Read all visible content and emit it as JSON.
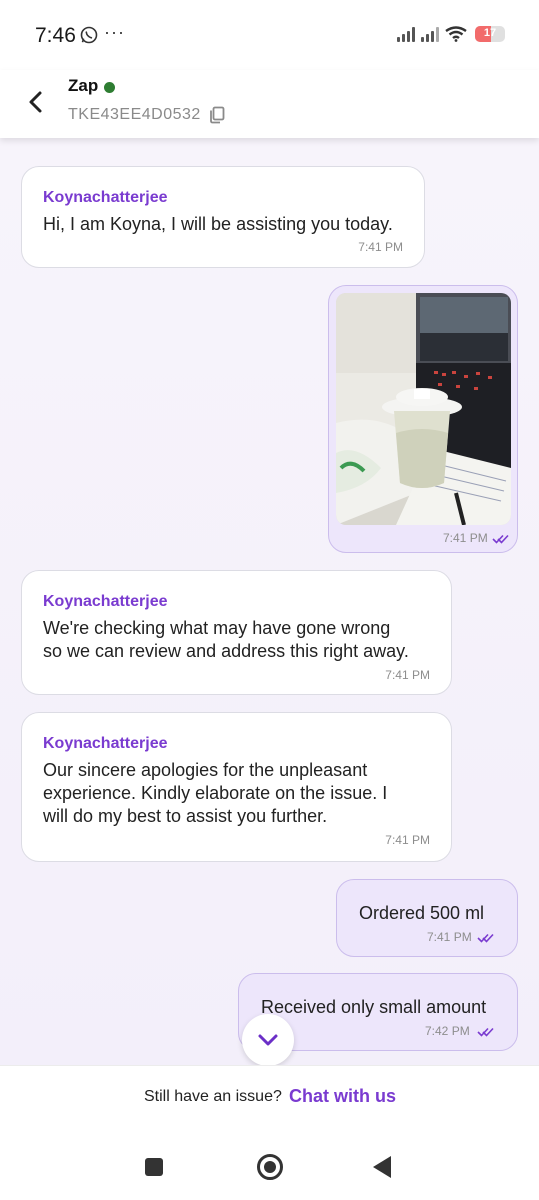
{
  "status_bar": {
    "time": "7:46",
    "overflow": "···",
    "battery": "17",
    "battery_level": 0.17
  },
  "header": {
    "title": "Zap",
    "ticket_id": "TKE43EE4D0532"
  },
  "messages": [
    {
      "sender": "Koynachatterjee",
      "lines": [
        "Hi, I am Koyna, I will be assisting you today."
      ],
      "time": "7:41 PM"
    },
    {
      "type": "image",
      "time": "7:41 PM"
    },
    {
      "sender": "Koynachatterjee",
      "lines": [
        "We're checking what may have gone wrong",
        "so we can review and address this right away."
      ],
      "time": "7:41 PM"
    },
    {
      "sender": "Koynachatterjee",
      "lines": [
        "Our sincere apologies for the unpleasant",
        "experience. Kindly elaborate on the issue. I",
        "will do my best to assist you further."
      ],
      "time": "7:41 PM"
    },
    {
      "text": "Ordered 500 ml",
      "time": "7:41 PM"
    },
    {
      "text": "Received only small amount",
      "time": "7:42 PM"
    }
  ],
  "footer": {
    "question": "Still have an issue?",
    "link": "Chat with us"
  },
  "colors": {
    "accent": "#7a3bd0",
    "outgoing_bubble": "#ede6fb",
    "online": "#2e7d32"
  }
}
